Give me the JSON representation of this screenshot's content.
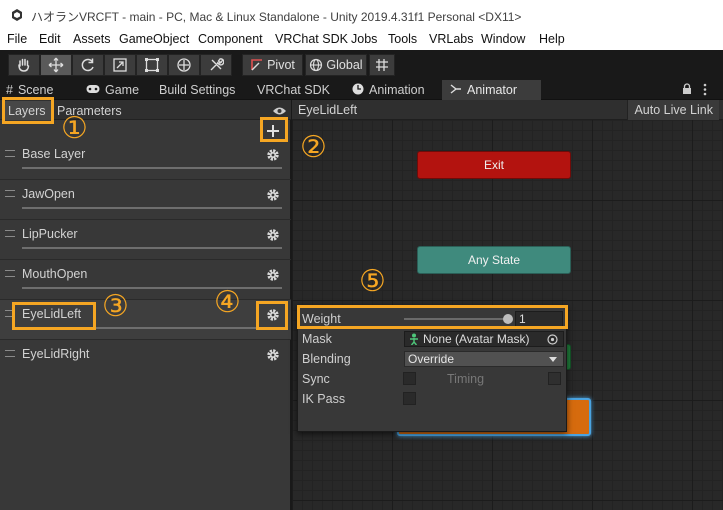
{
  "window": {
    "title": "ハオランVRCFT - main - PC, Mac & Linux Standalone - Unity 2019.4.31f1 Personal <DX11>"
  },
  "menu": [
    "File",
    "Edit",
    "Assets",
    "GameObject",
    "Component",
    "VRChat SDK",
    "Jobs",
    "Tools",
    "VRLabs",
    "Window",
    "Help"
  ],
  "toolbar": {
    "tools": [
      "hand-tool",
      "move-tool",
      "rotate-tool",
      "scale-tool",
      "rect-tool",
      "transform-tool",
      "custom-tool"
    ],
    "pivot_label": "Pivot",
    "global_label": "Global"
  },
  "tabs": [
    {
      "label": "Scene",
      "icon": "scene-icon"
    },
    {
      "label": "Game",
      "icon": "game-icon"
    },
    {
      "label": "Build Settings",
      "icon": ""
    },
    {
      "label": "VRChat SDK",
      "icon": ""
    },
    {
      "label": "Animation",
      "icon": "animation-icon"
    },
    {
      "label": "Animator",
      "icon": "animator-icon"
    }
  ],
  "animator": {
    "subtabs": [
      "Layers",
      "Parameters"
    ],
    "breadcrumb": "EyeLidLeft",
    "auto_live_link_label": "Auto Live Link",
    "layers": [
      "Base Layer",
      "JawOpen",
      "LipPucker",
      "MouthOpen",
      "EyeLidLeft",
      "EyeLidRight"
    ],
    "selected_layer": "EyeLidLeft",
    "states": {
      "exit": "Exit",
      "any_state": "Any State"
    }
  },
  "layer_settings": {
    "weight_label": "Weight",
    "weight_value": "1",
    "weight_fraction": 1.0,
    "mask_label": "Mask",
    "mask_value": "None (Avatar Mask)",
    "blending_label": "Blending",
    "blending_value": "Override",
    "sync_label": "Sync",
    "timing_label": "Timing",
    "ik_pass_label": "IK Pass"
  },
  "annotations": [
    "①",
    "②",
    "③",
    "④",
    "⑤"
  ],
  "colors": {
    "highlight": "#f5a623",
    "exit_state": "#b3130f",
    "any_state": "#3f8a7d",
    "default_state": "#d66b0e"
  }
}
